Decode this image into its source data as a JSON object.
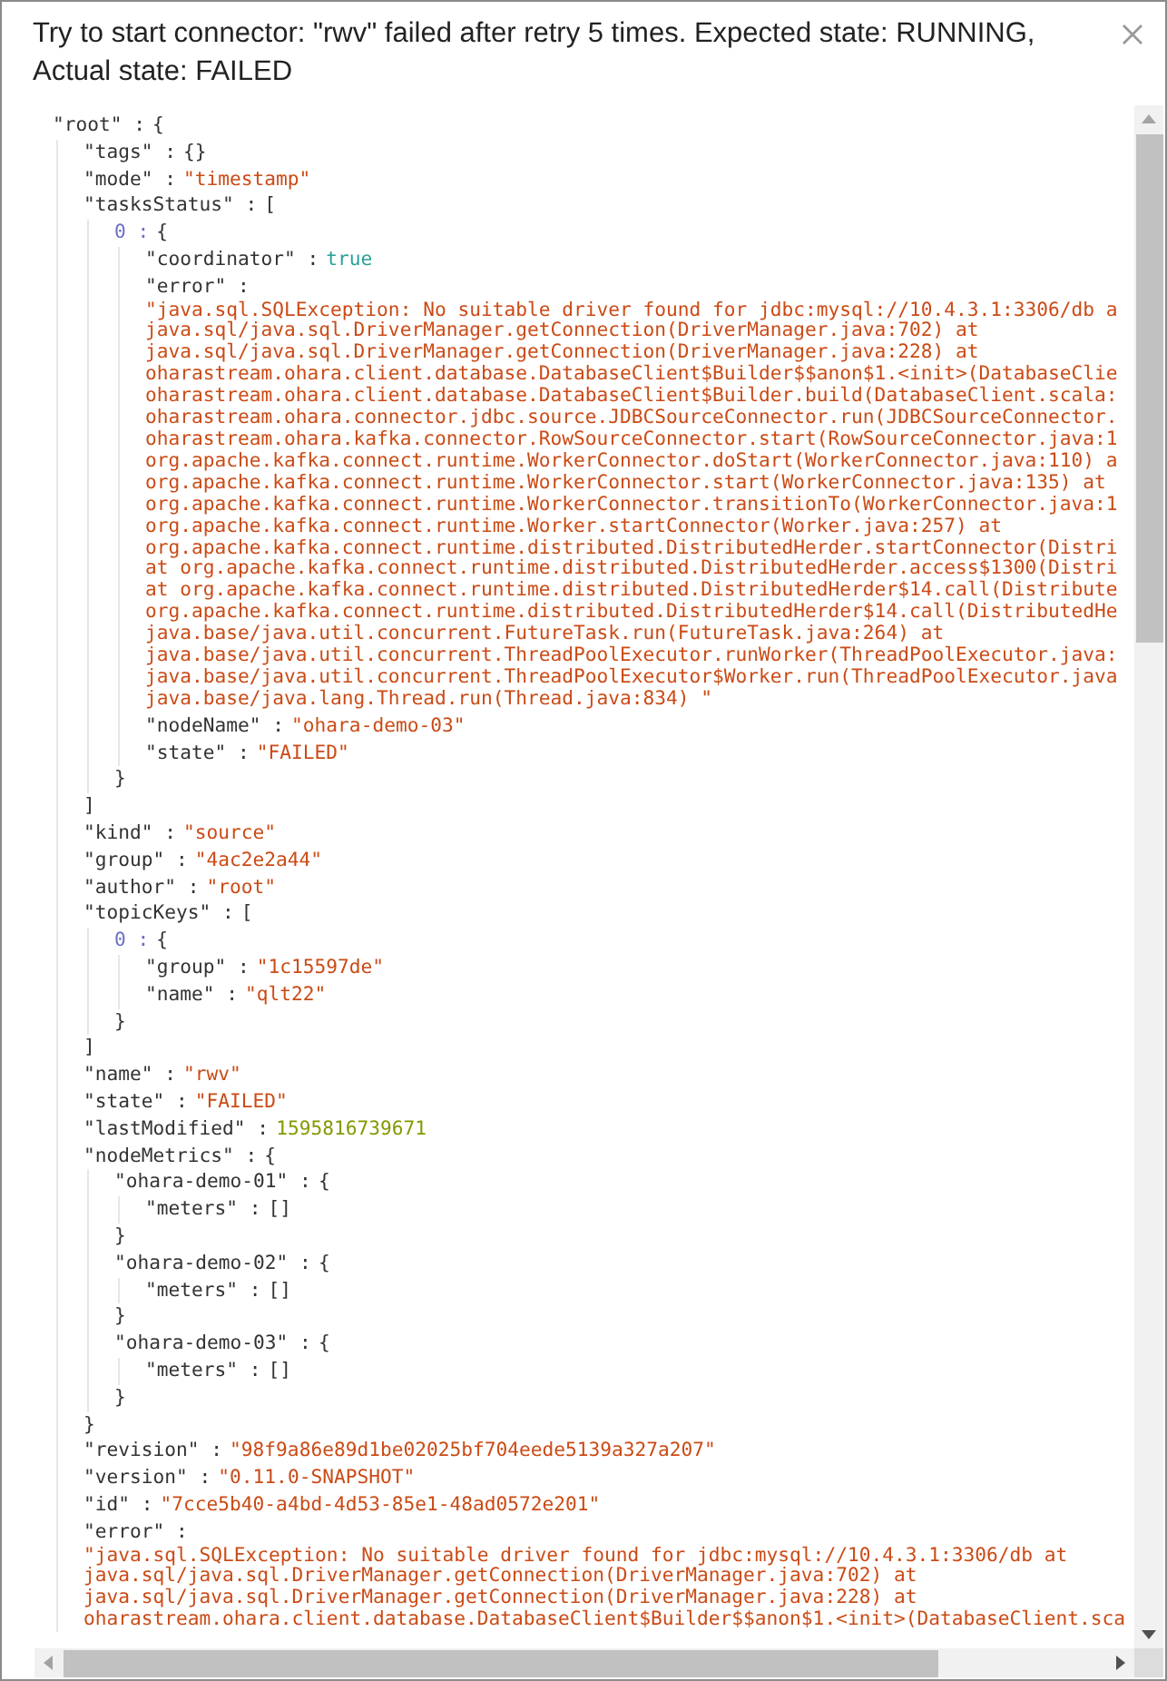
{
  "dialog": {
    "title": "Try to start connector: \"rwv\" failed after retry 5 times. Expected state: RUNNING, Actual state: FAILED"
  },
  "tree": {
    "key": "\"root\" :",
    "kind": "object",
    "open": "{",
    "children": [
      {
        "key": "\"tags\" :",
        "kind": "empty",
        "value": "{}"
      },
      {
        "key": "\"mode\" :",
        "kind": "string",
        "value": "\"timestamp\""
      },
      {
        "key": "\"tasksStatus\" :",
        "kind": "object",
        "open": "[",
        "close": "]",
        "children": [
          {
            "key": "0 :",
            "index": true,
            "kind": "object",
            "open": "{",
            "close": "}",
            "children": [
              {
                "key": "\"coordinator\" :",
                "kind": "boolean",
                "value": "true"
              },
              {
                "key": "\"error\" :",
                "kind": "multiline",
                "value": "\"java.sql.SQLException: No suitable driver found for jdbc:mysql://10.4.3.1:3306/db a\njava.sql/java.sql.DriverManager.getConnection(DriverManager.java:702) at\njava.sql/java.sql.DriverManager.getConnection(DriverManager.java:228) at\noharastream.ohara.client.database.DatabaseClient$Builder$$anon$1.<init>(DatabaseClie\noharastream.ohara.client.database.DatabaseClient$Builder.build(DatabaseClient.scala:\noharastream.ohara.connector.jdbc.source.JDBCSourceConnector.run(JDBCSourceConnector.\noharastream.ohara.kafka.connector.RowSourceConnector.start(RowSourceConnector.java:1\norg.apache.kafka.connect.runtime.WorkerConnector.doStart(WorkerConnector.java:110) a\norg.apache.kafka.connect.runtime.WorkerConnector.start(WorkerConnector.java:135) at\norg.apache.kafka.connect.runtime.WorkerConnector.transitionTo(WorkerConnector.java:1\norg.apache.kafka.connect.runtime.Worker.startConnector(Worker.java:257) at\norg.apache.kafka.connect.runtime.distributed.DistributedHerder.startConnector(Distri\nat org.apache.kafka.connect.runtime.distributed.DistributedHerder.access$1300(Distri\nat org.apache.kafka.connect.runtime.distributed.DistributedHerder$14.call(Distribute\norg.apache.kafka.connect.runtime.distributed.DistributedHerder$14.call(DistributedHe\njava.base/java.util.concurrent.FutureTask.run(FutureTask.java:264) at\njava.base/java.util.concurrent.ThreadPoolExecutor.runWorker(ThreadPoolExecutor.java:\njava.base/java.util.concurrent.ThreadPoolExecutor$Worker.run(ThreadPoolExecutor.java\njava.base/java.lang.Thread.run(Thread.java:834) \""
              },
              {
                "key": "\"nodeName\" :",
                "kind": "string",
                "value": "\"ohara-demo-03\""
              },
              {
                "key": "\"state\" :",
                "kind": "string",
                "value": "\"FAILED\""
              }
            ]
          }
        ]
      },
      {
        "key": "\"kind\" :",
        "kind": "string",
        "value": "\"source\""
      },
      {
        "key": "\"group\" :",
        "kind": "string",
        "value": "\"4ac2e2a44\""
      },
      {
        "key": "\"author\" :",
        "kind": "string",
        "value": "\"root\""
      },
      {
        "key": "\"topicKeys\" :",
        "kind": "object",
        "open": "[",
        "close": "]",
        "children": [
          {
            "key": "0 :",
            "index": true,
            "kind": "object",
            "open": "{",
            "close": "}",
            "children": [
              {
                "key": "\"group\" :",
                "kind": "string",
                "value": "\"1c15597de\""
              },
              {
                "key": "\"name\" :",
                "kind": "string",
                "value": "\"qlt22\""
              }
            ]
          }
        ]
      },
      {
        "key": "\"name\" :",
        "kind": "string",
        "value": "\"rwv\""
      },
      {
        "key": "\"state\" :",
        "kind": "string",
        "value": "\"FAILED\""
      },
      {
        "key": "\"lastModified\" :",
        "kind": "number",
        "value": "1595816739671"
      },
      {
        "key": "\"nodeMetrics\" :",
        "kind": "object",
        "open": "{",
        "close": "}",
        "children": [
          {
            "key": "\"ohara-demo-01\" :",
            "kind": "object",
            "open": "{",
            "close": "}",
            "children": [
              {
                "key": "\"meters\" :",
                "kind": "empty",
                "value": "[]"
              }
            ]
          },
          {
            "key": "\"ohara-demo-02\" :",
            "kind": "object",
            "open": "{",
            "close": "}",
            "children": [
              {
                "key": "\"meters\" :",
                "kind": "empty",
                "value": "[]"
              }
            ]
          },
          {
            "key": "\"ohara-demo-03\" :",
            "kind": "object",
            "open": "{",
            "close": "}",
            "children": [
              {
                "key": "\"meters\" :",
                "kind": "empty",
                "value": "[]"
              }
            ]
          }
        ]
      },
      {
        "key": "\"revision\" :",
        "kind": "string",
        "value": "\"98f9a86e89d1be02025bf704eede5139a327a207\""
      },
      {
        "key": "\"version\" :",
        "kind": "string",
        "value": "\"0.11.0-SNAPSHOT\""
      },
      {
        "key": "\"id\" :",
        "kind": "string",
        "value": "\"7cce5b40-a4bd-4d53-85e1-48ad0572e201\""
      },
      {
        "key": "\"error\" :",
        "kind": "multiline",
        "value": "\"java.sql.SQLException: No suitable driver found for jdbc:mysql://10.4.3.1:3306/db at\njava.sql/java.sql.DriverManager.getConnection(DriverManager.java:702) at\njava.sql/java.sql.DriverManager.getConnection(DriverManager.java:228) at\noharastream.ohara.client.database.DatabaseClient$Builder$$anon$1.<init>(DatabaseClient.sca"
      }
    ]
  }
}
